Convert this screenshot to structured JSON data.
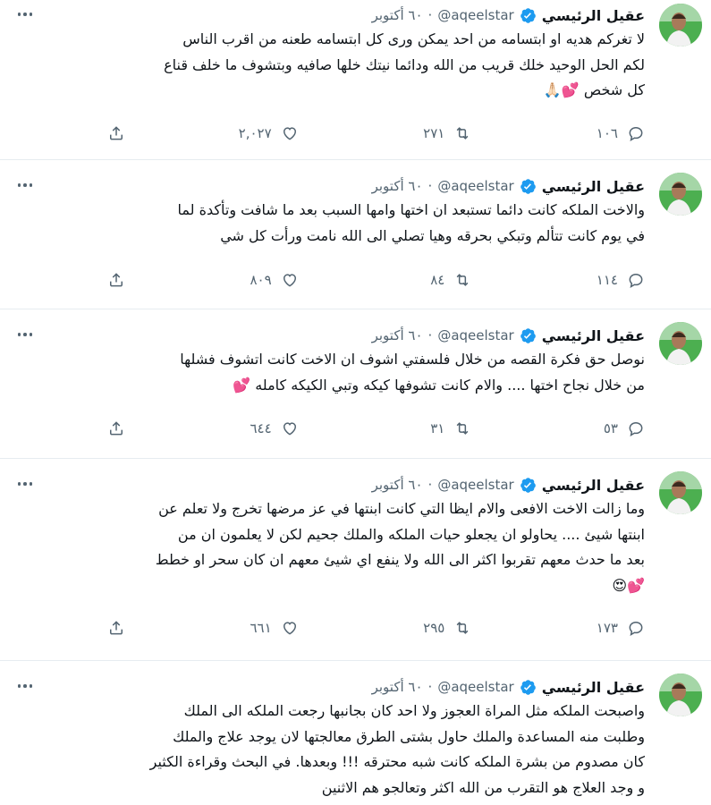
{
  "author": {
    "name": "عقيل الرئيسي",
    "handle": "@aqeelstar",
    "verified_icon": "verified-badge-icon",
    "avatar": "profile-photo-man-green-background"
  },
  "colors": {
    "verified": "#1d9bf0",
    "secondary_text": "#536471",
    "divider": "#e6ecf0"
  },
  "tweets": [
    {
      "time": "٦٠ أكتوبر",
      "text": "لا تغركم هديه او ابتسامه من احد يمكن ورى كل ابتسامه طعنه من اقرب الناس\nلكم الحل الوحيد خلك قريب من الله ودائما نيتك خلها صافيه وبتشوف ما خلف قناع\nكل شخص 💕🙏🏻",
      "replies": "١٠٦",
      "retweets": "٢٧١",
      "likes": "٢,٠٢٧"
    },
    {
      "time": "٦٠ أكتوبر",
      "text": "والاخت الملكه كانت دائما تستبعد ان اختها وامها السبب بعد ما شافت وتأكدة لما\nفي يوم كانت تتألم وتبكي بحرقه وهيا تصلي الى الله نامت ورأت كل شي",
      "replies": "١١٤",
      "retweets": "٨٤",
      "likes": "٨٠٩"
    },
    {
      "time": "٦٠ أكتوبر",
      "text": "نوصل حق فكرة القصه من خلال فلسفتي اشوف ان الاخت كانت اتشوف فشلها\nمن خلال نجاح اختها .... والام كانت تشوفها كيكه وتبي الكيكه كامله 💕",
      "replies": "٥٣",
      "retweets": "٣١",
      "likes": "٦٤٤"
    },
    {
      "time": "٦٠ أكتوبر",
      "text": "وما زالت الاخت الافعى والام ايظا التي كانت ابنتها في عز مرضها تخرج ولا تعلم عن\nابنتها شيئ .... يحاولو ان يجعلو حيات الملكه والملك جحيم لكن لا يعلمون ان من\nبعد ما حدث معهم تقربوا اكثر الى الله ولا ينفع اي شيئ معهم ان كان سحر او خطط\n💕😍",
      "replies": "١٧٣",
      "retweets": "٢٩٥",
      "likes": "٦٦١"
    },
    {
      "time": "٦٠ أكتوبر",
      "text": "واصبحت الملكه مثل المراة العجوز ولا احد كان بجانبها رجعت الملكه الى الملك\nوطلبت منه المساعدة والملك حاول بشتى الطرق معالجتها لان يوجد علاج والملك\nكان مصدوم من بشرة الملكه كانت شبه محترقه !!! وبعدها. في البحث وقراءة الكثير\nو وجد العلاج هو التقرب من الله اكثر وتعالجو هم الاثنين",
      "replies": "",
      "retweets": "",
      "likes": ""
    }
  ]
}
